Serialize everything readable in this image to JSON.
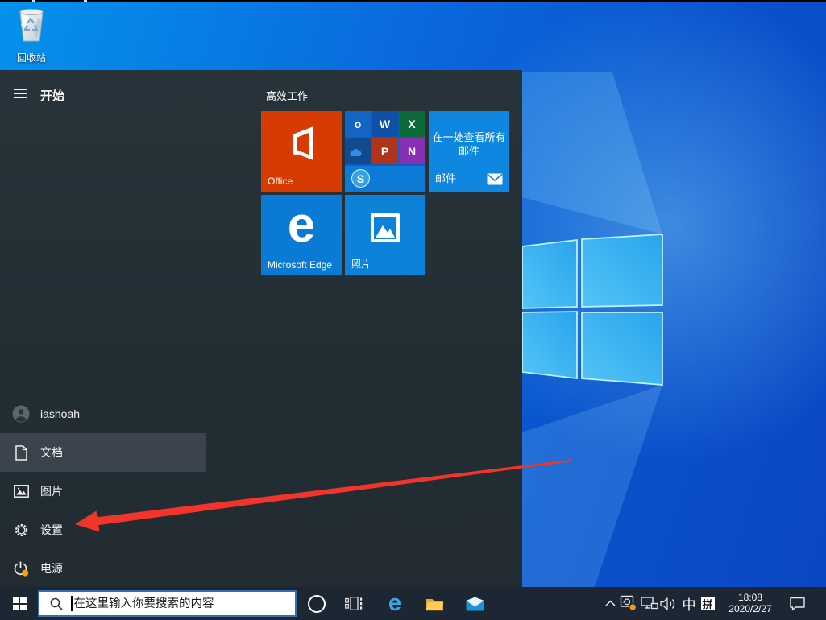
{
  "desktop": {
    "recycle_bin_label": "回收站"
  },
  "start_menu": {
    "title": "开始",
    "group_title": "高效工作",
    "tiles": {
      "office": {
        "label": "Office"
      },
      "office_folder": {
        "apps": [
          {
            "name": "Outlook",
            "letter": "o"
          },
          {
            "name": "Word",
            "letter": "W"
          },
          {
            "name": "Excel",
            "letter": "X"
          },
          {
            "name": "OneDrive",
            "letter": ""
          },
          {
            "name": "PowerPoint",
            "letter": "P"
          },
          {
            "name": "OneNote",
            "letter": "N"
          },
          {
            "name": "Skype",
            "letter": "S"
          }
        ]
      },
      "mail": {
        "line1": "在一处查看所有",
        "line2": "邮件",
        "label": "邮件"
      },
      "edge": {
        "letter": "e",
        "label": "Microsoft Edge"
      },
      "photos": {
        "label": "照片"
      }
    },
    "sidebar": {
      "user": {
        "label": "iashoah"
      },
      "documents": {
        "label": "文档"
      },
      "pictures": {
        "label": "图片"
      },
      "settings": {
        "label": "设置"
      },
      "power": {
        "label": "电源"
      }
    }
  },
  "taskbar": {
    "search_placeholder": "在这里输入你要搜索的内容",
    "tray": {
      "ime_mode": "中",
      "ime_pinyin": "拼",
      "time": "18:08",
      "date": "2020/2/27"
    }
  },
  "colors": {
    "accent": "#0078d7",
    "office_tile": "#d83b01",
    "tile_blue": "#0f82dc",
    "taskbar": "#1c2733",
    "menu_bg": "#242e35",
    "arrow": "#f1352b",
    "update_dot": "#f7941d"
  }
}
